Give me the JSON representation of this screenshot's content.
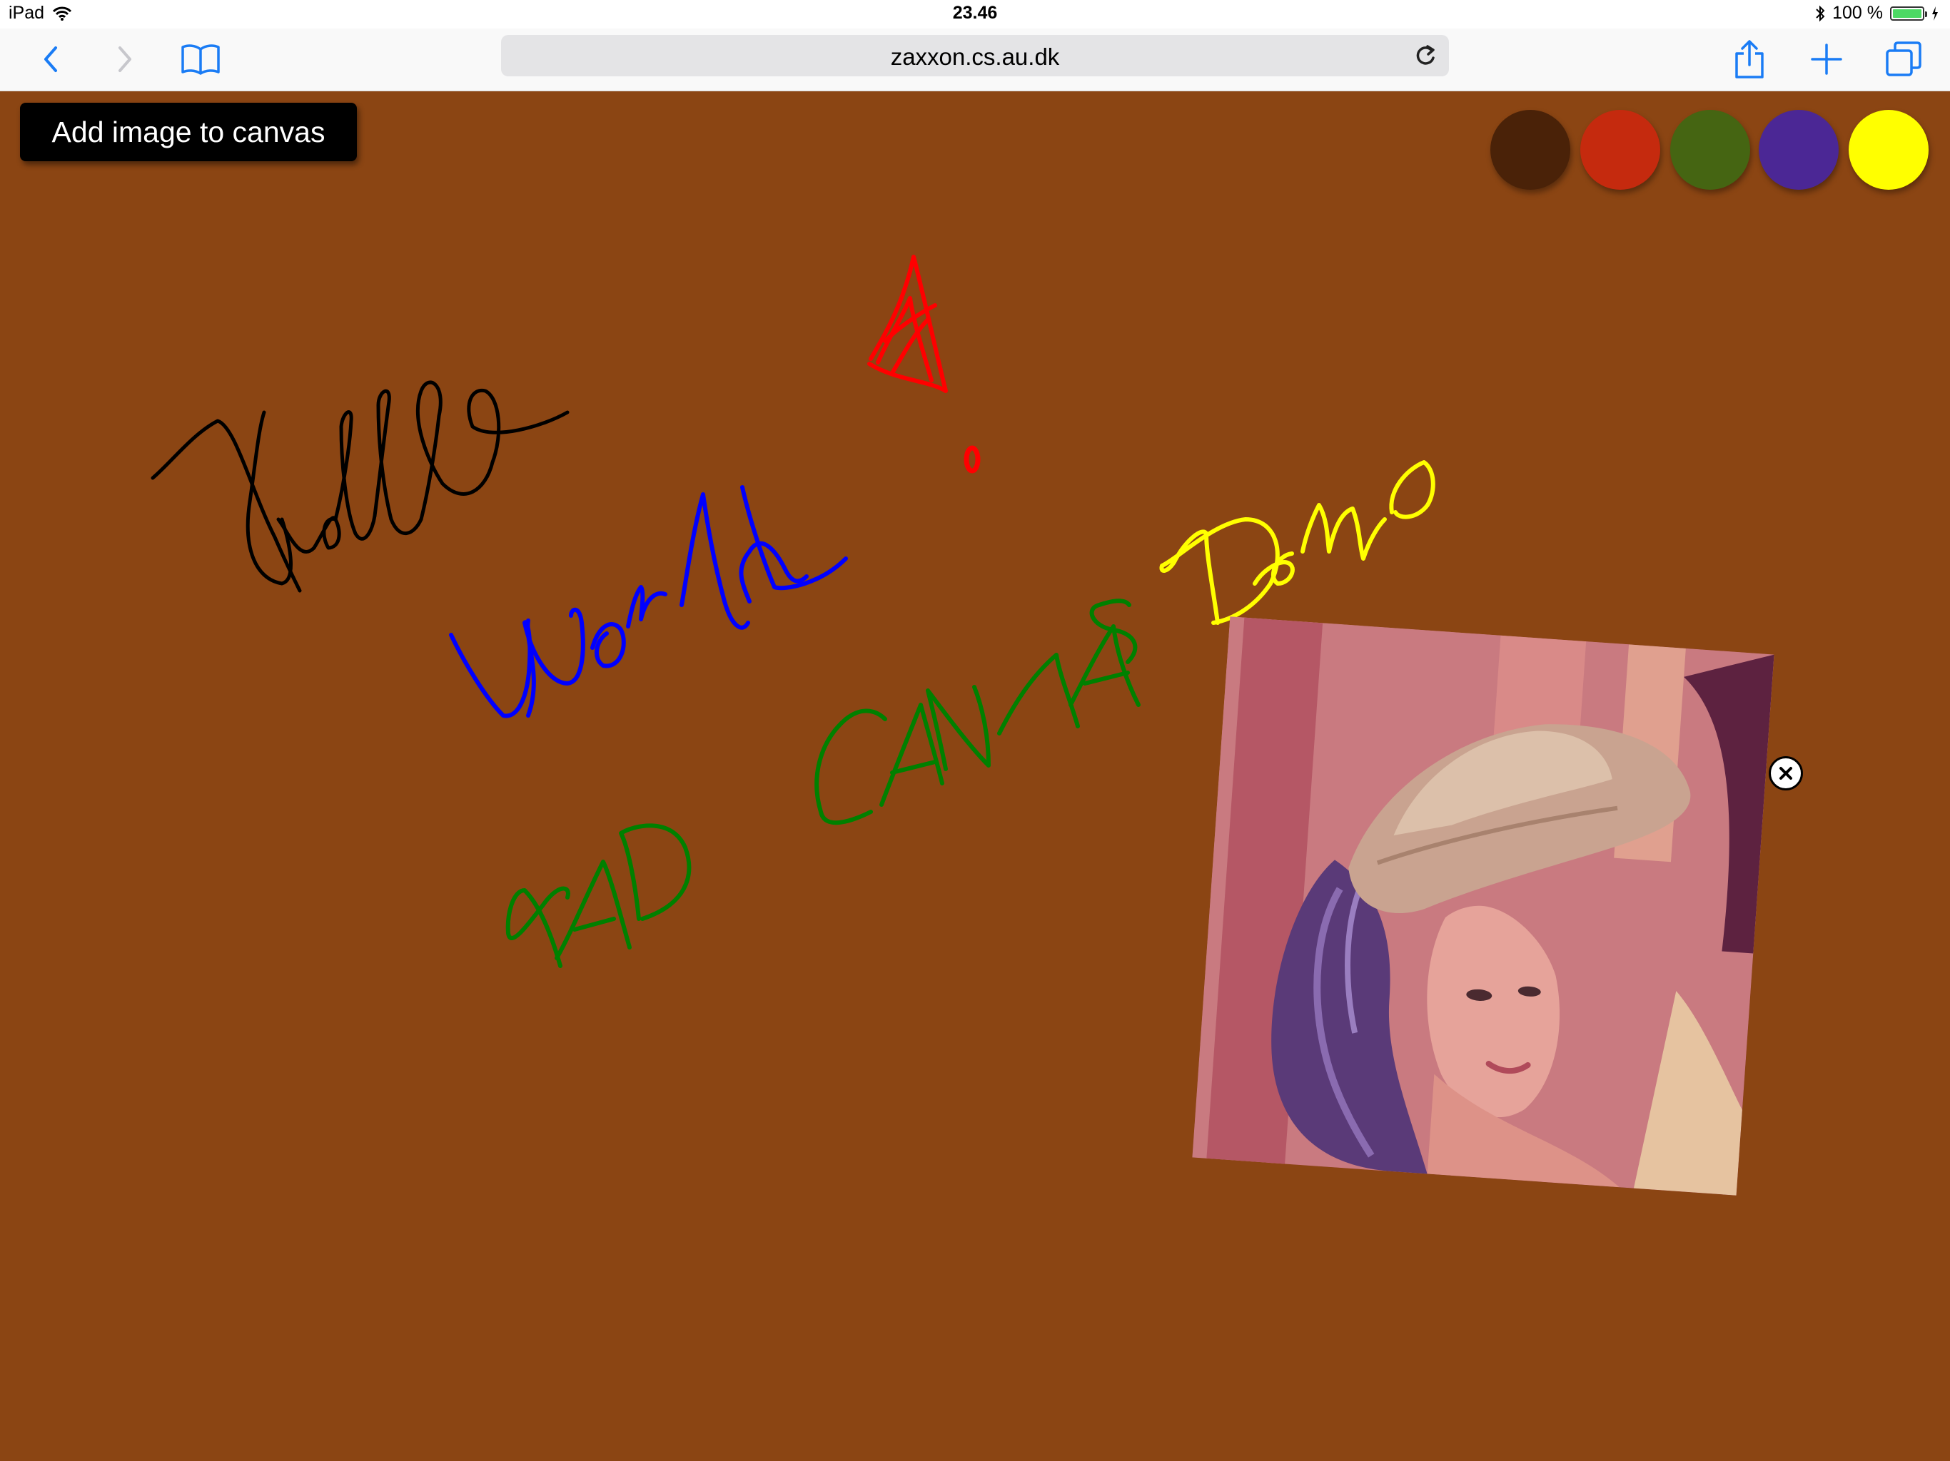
{
  "status_bar": {
    "device": "iPad",
    "time": "23.46",
    "battery_text": "100 %",
    "battery_level": 1.0,
    "icons": [
      "wifi-icon",
      "bluetooth-icon",
      "battery-icon",
      "charging-icon"
    ]
  },
  "browser": {
    "url": "zaxxon.cs.au.dk",
    "icons": [
      "back-icon",
      "forward-icon",
      "bookmarks-icon",
      "reload-icon",
      "share-icon",
      "new-tab-icon",
      "tabs-icon"
    ]
  },
  "canvas": {
    "background_color": "#8b4513",
    "add_image_label": "Add image to canvas",
    "palette": [
      {
        "name": "dark-brown",
        "color": "#4a2208"
      },
      {
        "name": "red",
        "color": "#c52a0e"
      },
      {
        "name": "green",
        "color": "#456512"
      },
      {
        "name": "purple",
        "color": "#4b2795"
      },
      {
        "name": "yellow",
        "color": "#ffff00"
      }
    ],
    "strokes": [
      {
        "text": "Hello",
        "color": "#000000"
      },
      {
        "text": "World",
        "color": "#0000ff"
      },
      {
        "text": "!",
        "color": "#ff0000"
      },
      {
        "text": "PAD CANVAS",
        "color": "#008000"
      },
      {
        "text": "Demo",
        "color": "#ffff00"
      }
    ],
    "image": {
      "description_icon": "portrait-photo",
      "close_icon": "close-icon"
    }
  }
}
